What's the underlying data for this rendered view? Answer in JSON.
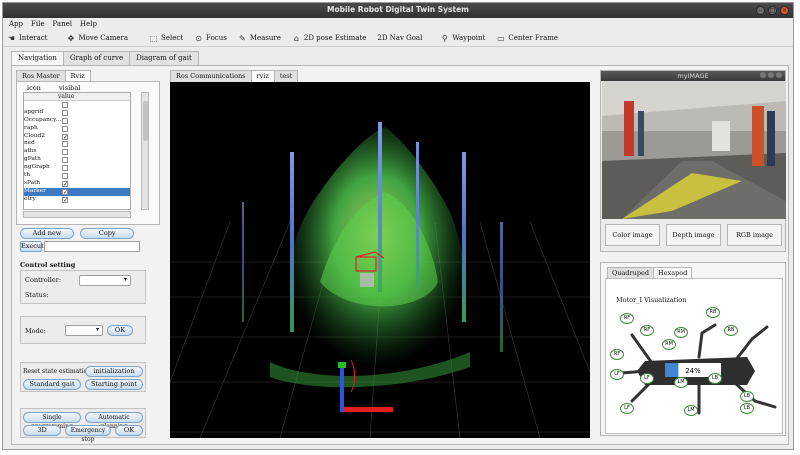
{
  "window": {
    "title": "Mobile Robot Digital Twin System"
  },
  "menu": [
    "App",
    "File",
    "Panel",
    "Help"
  ],
  "toolbar": {
    "interact": "Interact",
    "move_camera": "Move Camera",
    "select": "Select",
    "focus": "Focus",
    "measure": "Measure",
    "pose_estimate": "2D pose Estimate",
    "nav_goal": "2D Nav Goal",
    "waypoint": "Waypoint",
    "center_frame": "Center Frame"
  },
  "main_tabs": [
    "Navigation",
    "Graph of curve",
    "Diagram of gait"
  ],
  "left": {
    "tabs": [
      "Ros Master",
      "Rviz"
    ],
    "col_icon": "icon",
    "col_visibal": "visibal",
    "col_value": "value",
    "displays": [
      {
        "name": "",
        "checked": false
      },
      {
        "name": "apgrid",
        "checked": false
      },
      {
        "name": "Occupancy...",
        "checked": false
      },
      {
        "name": "raph",
        "checked": false
      },
      {
        "name": "Cloud2",
        "checked": true
      },
      {
        "name": "ned",
        "checked": false
      },
      {
        "name": "aths",
        "checked": false
      },
      {
        "name": "gPath",
        "checked": false
      },
      {
        "name": "ngGraph",
        "checked": false
      },
      {
        "name": "th",
        "checked": false
      },
      {
        "name": "sPath",
        "checked": true
      },
      {
        "name": "Marker",
        "checked": true,
        "selected": true
      },
      {
        "name": "etry",
        "checked": true
      }
    ],
    "add_new": "Add new",
    "copy": "Copy",
    "execute": "Execute",
    "control_setting": "Control setting",
    "controller_label": "Controller:",
    "status_label": "Status:",
    "mode_label": "Mode:",
    "ok": "OK",
    "reset_state": "Reset state estimation",
    "initialization": "initialization",
    "standard_gait": "Standard gait",
    "starting_point": "Starting point",
    "single_programming": "Single programming",
    "automatic_planning": "Automatic planning",
    "btn_3d": "3D",
    "emergency_stop": "Emergency stop",
    "ok2": "OK"
  },
  "center": {
    "tabs": [
      "Ros Communications",
      "rviz",
      "test"
    ]
  },
  "right": {
    "image_title": "myIMAGE",
    "color_image": "Color image",
    "depth_image": "Depth image",
    "rgb_image": "RGB image",
    "gait_tabs": [
      "Quadruped",
      "Hexapod"
    ],
    "motor_title": "Motor_I Visualization",
    "progress_percent": 24,
    "progress_label": "24%",
    "legs": {
      "rf_top": "RF",
      "rm_top": "RM",
      "rb_top": "RB",
      "rf_out": "RF",
      "lf_out": "LF",
      "lf_bot": "LF",
      "lm_bot": "LM",
      "lb_bot": "LB",
      "lb_mid": "LB",
      "rf_in": "RF",
      "rm_in": "RM",
      "rb_in": "RB",
      "lf_in": "LF",
      "lm_in": "LM",
      "lb_in": "LB"
    }
  },
  "colors": {
    "accent": "#3f78c2",
    "pointcloud": "#4fd24f",
    "axis_x": "#e02020",
    "axis_z": "#2050e0",
    "axis_y": "#20c020"
  }
}
